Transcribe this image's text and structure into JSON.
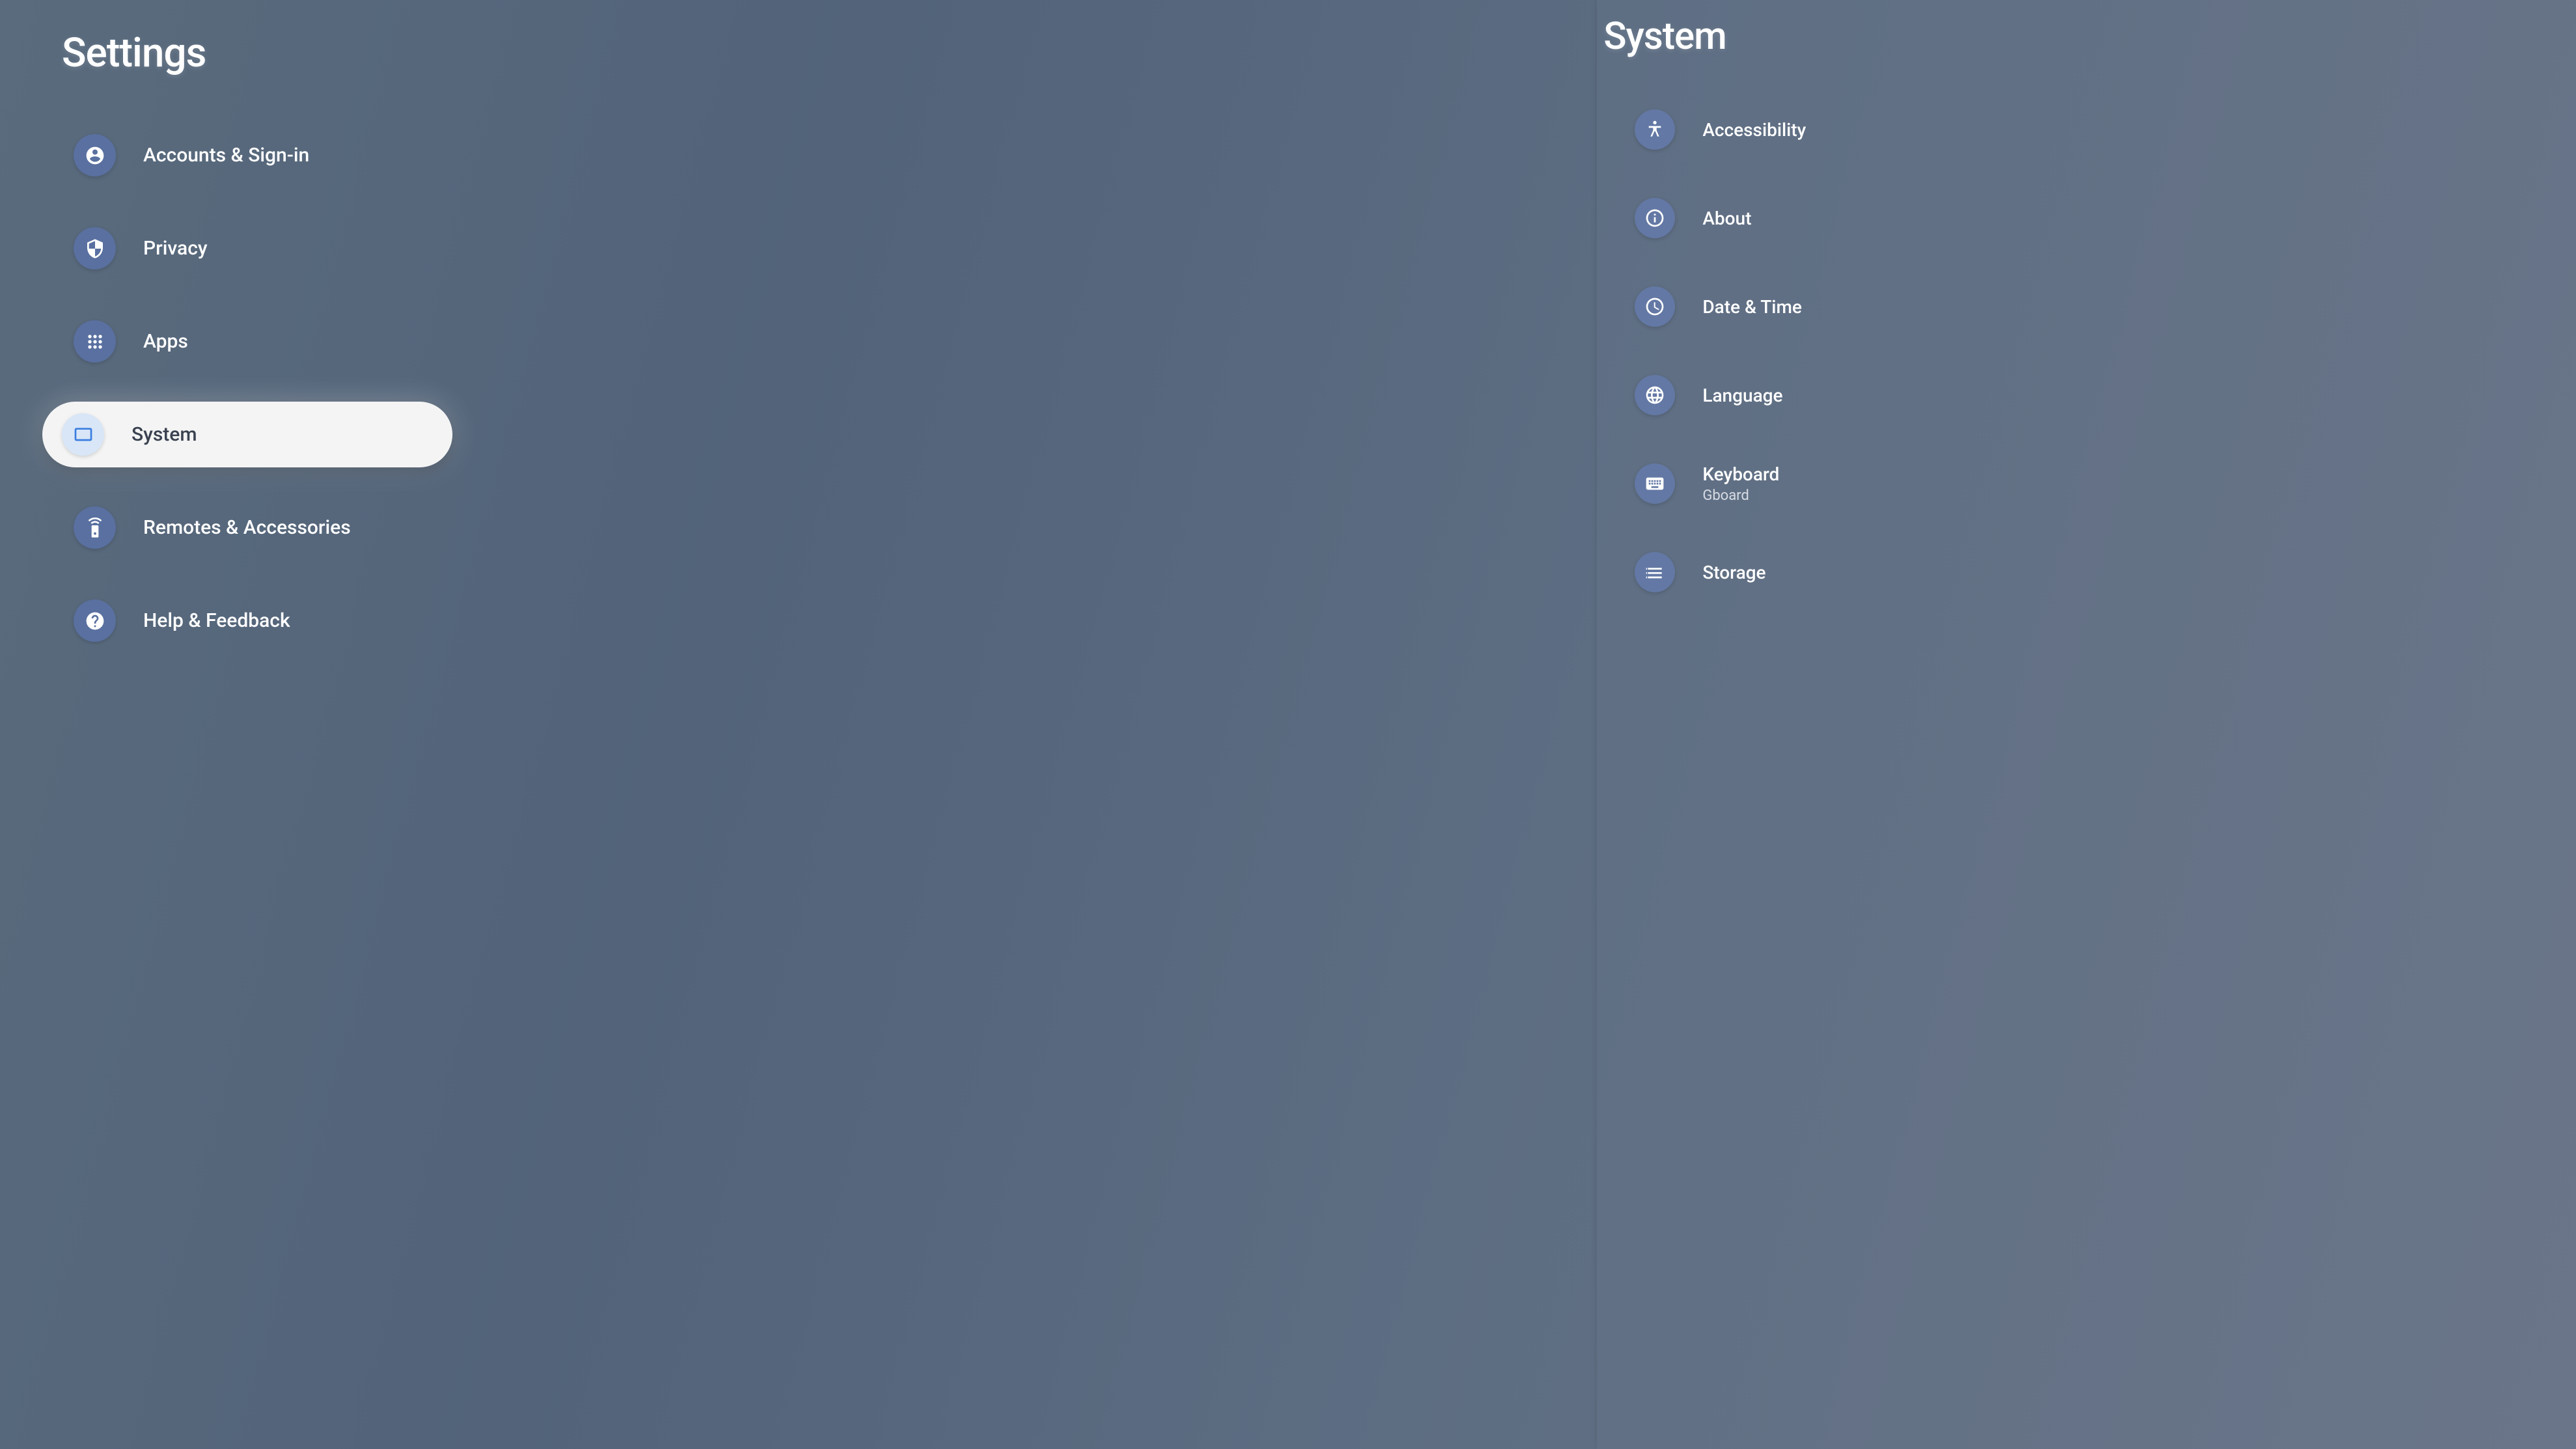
{
  "leftPanel": {
    "title": "Settings",
    "items": [
      {
        "label": "Accounts & Sign-in",
        "icon": "account",
        "selected": false
      },
      {
        "label": "Privacy",
        "icon": "shield",
        "selected": false
      },
      {
        "label": "Apps",
        "icon": "apps",
        "selected": false
      },
      {
        "label": "System",
        "icon": "tv",
        "selected": true
      },
      {
        "label": "Remotes & Accessories",
        "icon": "remote",
        "selected": false
      },
      {
        "label": "Help & Feedback",
        "icon": "help",
        "selected": false
      }
    ]
  },
  "rightPanel": {
    "title": "System",
    "items": [
      {
        "label": "Accessibility",
        "icon": "accessibility",
        "subtitle": null
      },
      {
        "label": "About",
        "icon": "info",
        "subtitle": null
      },
      {
        "label": "Date & Time",
        "icon": "clock",
        "subtitle": null
      },
      {
        "label": "Language",
        "icon": "globe",
        "subtitle": null
      },
      {
        "label": "Keyboard",
        "icon": "keyboard",
        "subtitle": "Gboard"
      },
      {
        "label": "Storage",
        "icon": "storage",
        "subtitle": null
      }
    ]
  }
}
